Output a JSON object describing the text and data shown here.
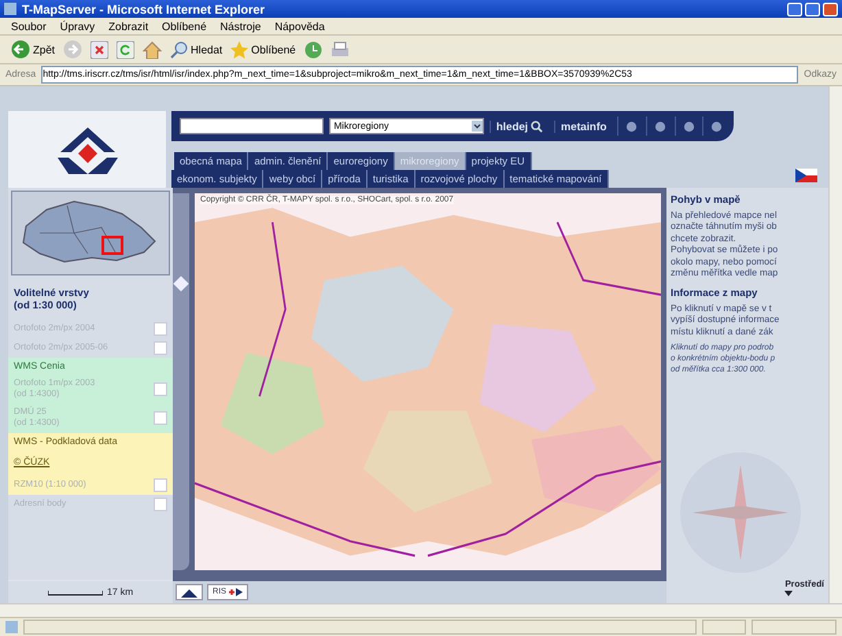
{
  "window": {
    "title": "T-MapServer - Microsoft Internet Explorer"
  },
  "menu": [
    "Soubor",
    "Úpravy",
    "Zobrazit",
    "Oblíbené",
    "Nástroje",
    "Nápověda"
  ],
  "toolbar": {
    "back": "Zpět",
    "search": "Hledat",
    "favorites": "Oblíbené"
  },
  "address_bar": {
    "label": "Adresa",
    "url": "http://tms.iriscrr.cz/tms/isr/html/isr/index.php?m_next_time=1&subproject=mikro&m_next_time=1&m_next_time=1&BBOX=3570939%2C53",
    "links": "Odkazy"
  },
  "zoom_slider": {
    "level": 0.75
  },
  "search_bar": {
    "layer_select": "Mikroregiony",
    "search_button": "hledej",
    "metainfo_button": "metainfo"
  },
  "tabs_row_1": [
    {
      "label": "obecná mapa",
      "selected": false
    },
    {
      "label": "admin. členění",
      "selected": false
    },
    {
      "label": "euroregiony",
      "selected": false
    },
    {
      "label": "mikroregiony",
      "selected": true
    },
    {
      "label": "projekty EU",
      "selected": false
    }
  ],
  "tabs_row_2": [
    {
      "label": "ekonom. subjekty",
      "selected": false
    },
    {
      "label": "weby obcí",
      "selected": false
    },
    {
      "label": "příroda",
      "selected": false
    },
    {
      "label": "turistika",
      "selected": false
    },
    {
      "label": "rozvojové plochy",
      "selected": false
    },
    {
      "label": "tematické mapování",
      "selected": false
    }
  ],
  "layers_panel": {
    "title": "Volitelné vrstvy",
    "subtitle": "(od 1:30 000)",
    "items": [
      {
        "kind": "layer",
        "label": "Ortofoto 2m/px 2004",
        "checked": false,
        "disabled": true
      },
      {
        "kind": "layer",
        "label": "Ortofoto 2m/px 2005-06",
        "checked": false,
        "disabled": true
      },
      {
        "kind": "group",
        "label": "WMS Cenia",
        "color": "#c8f0d8"
      },
      {
        "kind": "layer",
        "label": "Ortofoto 1m/px 2003",
        "note": "(od 1:4300)",
        "checked": false,
        "disabled": true,
        "color": "#c8f0d8"
      },
      {
        "kind": "layer",
        "label": "DMÚ 25",
        "note": "(od 1:4300)",
        "checked": false,
        "disabled": true,
        "color": "#c8f0d8"
      },
      {
        "kind": "group",
        "label": "WMS - Podkladová data",
        "link": "© ČÚZK",
        "color": "#fbf3b8"
      },
      {
        "kind": "layer",
        "label": "RZM10 (1:10 000)",
        "checked": false,
        "disabled": true,
        "color": "#fbf3b8"
      },
      {
        "kind": "layer",
        "label": "Adresní body",
        "checked": false,
        "disabled": true
      }
    ]
  },
  "map": {
    "copyright": "Copyright © CRR ČR, T-MAPY spol. s r.o., SHOCart, spol. s r.o. 2007"
  },
  "scale": "17 km",
  "partner_logos": {
    "second": "RIS"
  },
  "info_panel": {
    "sections": [
      {
        "kind": "heading",
        "lines": [
          "Pohyb v mapě"
        ]
      },
      {
        "kind": "text",
        "lines": [
          "Na přehledové mapce nel",
          "označte táhnutím myši ob",
          "chcete zobrazit.",
          "Pohybovat se můžete i po",
          "okolo mapy, nebo pomocí",
          "změnu měřítka vedle map"
        ]
      },
      {
        "kind": "heading",
        "lines": [
          "Informace z mapy"
        ]
      },
      {
        "kind": "text",
        "lines": [
          "Po kliknutí v mapě se v t",
          "vypíší dostupné informace",
          "místu kliknutí a dané zák"
        ]
      },
      {
        "kind": "note",
        "lines": [
          "Kliknutí do mapy pro podrob",
          "o konkrétním objektu-bodu p",
          "od měřítka cca 1:300 000."
        ]
      }
    ],
    "dropdown": "Prostředí"
  }
}
